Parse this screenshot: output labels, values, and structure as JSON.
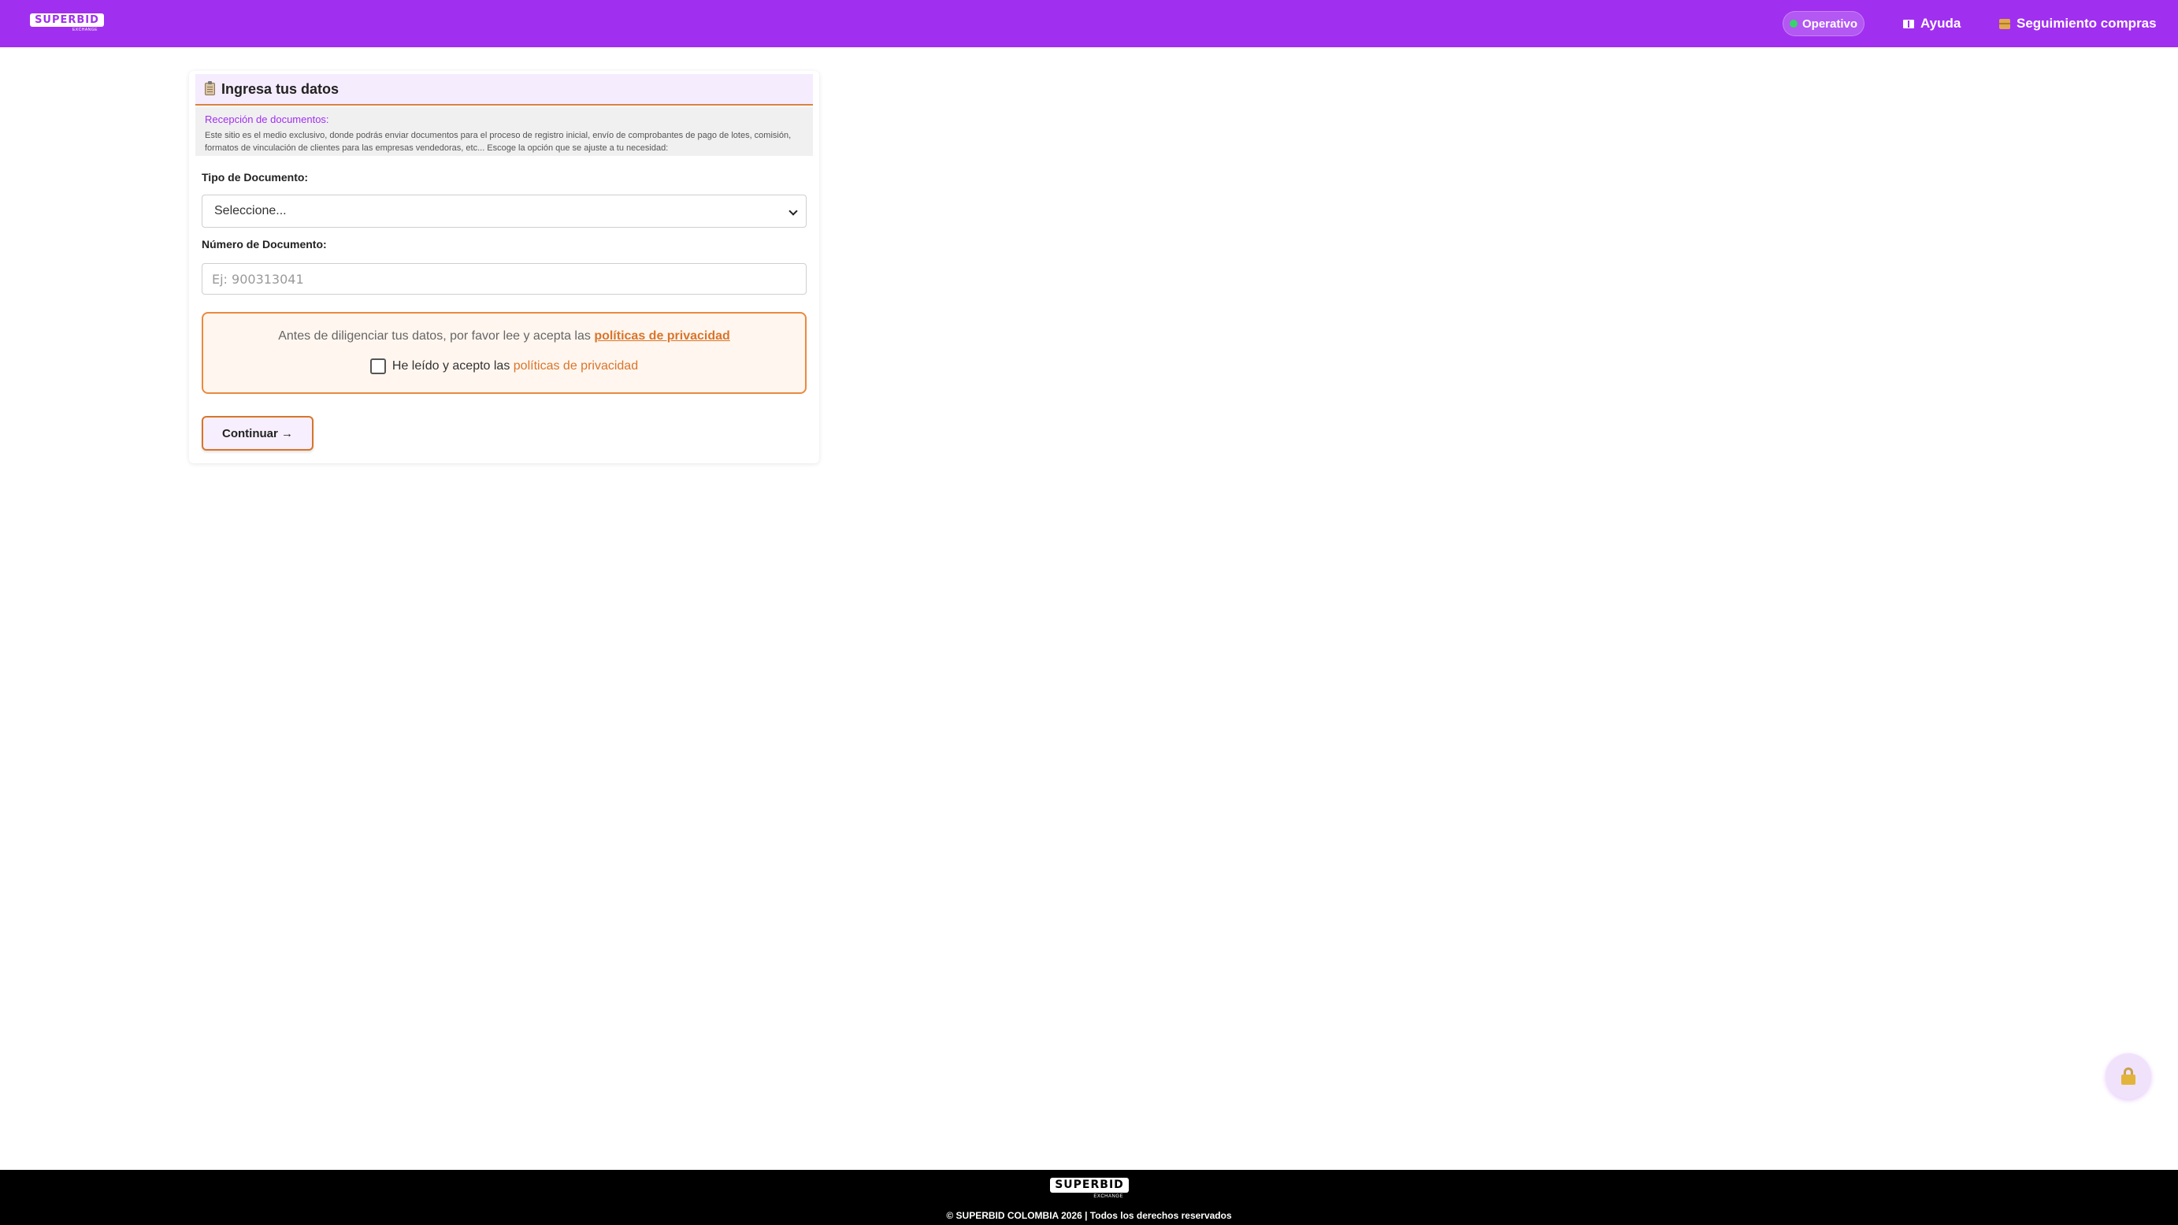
{
  "header": {
    "logo_text": "SUPERBID",
    "logo_sub": "EXCHANGE",
    "status_label": "Operativo",
    "nav_ayuda": "Ayuda",
    "nav_seguimiento": "Seguimiento compras",
    "brand_color": "#a12ff0",
    "status_color": "#38d36b"
  },
  "form": {
    "title": "Ingresa tus datos",
    "info_title": "Recepción de documentos:",
    "info_text": "Este sitio es el medio exclusivo, donde podrás enviar documentos para el proceso de registro inicial, envío de comprobantes de pago de lotes, comisión, formatos de vinculación de clientes para las empresas vendedoras, etc... Escoge la opción que se ajuste a tu necesidad:",
    "tipo_label": "Tipo de Documento:",
    "tipo_selected": "Seleccione...",
    "numero_label": "Número de Documento:",
    "numero_placeholder": "Ej: 900313041",
    "privacy_prefix": "Antes de diligenciar tus datos, por favor lee y acepta las ",
    "privacy_link": "políticas de privacidad",
    "accept_prefix": "He leído y acepto las ",
    "accept_link": "políticas de privacidad",
    "accept_checked": false,
    "continue_label": "Continuar →",
    "accent_color": "#d9752b"
  },
  "footer": {
    "logo_text": "SUPERBID",
    "logo_sub": "EXCHANGE",
    "copyright": "© SUPERBID COLOMBIA 2026 | Todos los derechos reservados"
  },
  "icons": {
    "status": "status-dot-icon",
    "ayuda": "book-icon",
    "seguimiento": "package-icon",
    "title": "clipboard-icon",
    "select": "chevron-down-icon",
    "fab": "lock-icon"
  }
}
